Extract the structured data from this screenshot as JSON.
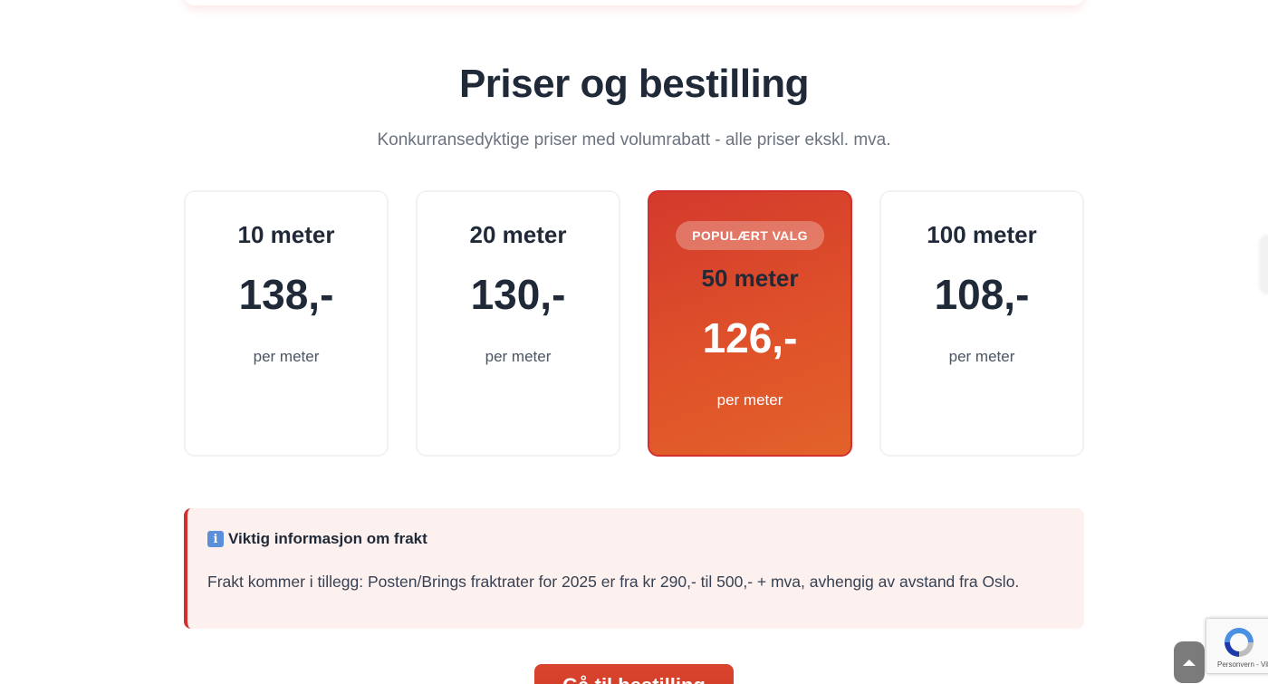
{
  "section": {
    "title": "Priser og bestilling",
    "subtitle": "Konkurransedyktige priser med volumrabatt - alle priser ekskl. mva."
  },
  "pricing": [
    {
      "quantity": "10 meter",
      "price": "138,-",
      "unit": "per meter",
      "featured": false
    },
    {
      "quantity": "20 meter",
      "price": "130,-",
      "unit": "per meter",
      "featured": false
    },
    {
      "quantity": "50 meter",
      "price": "126,-",
      "unit": "per meter",
      "featured": true,
      "badge": "POPULÆRT VALG"
    },
    {
      "quantity": "100 meter",
      "price": "108,-",
      "unit": "per meter",
      "featured": false
    }
  ],
  "info": {
    "icon": "info-icon",
    "icon_glyph": "i",
    "heading": "Viktig informasjon om frakt",
    "text": "Frakt kommer i tillegg: Posten/Brings fraktrater for 2025 er fra kr 290,- til 500,- + mva, avhengig av avstand fra Oslo."
  },
  "order_button": {
    "label": "Gå til bestilling"
  },
  "recaptcha": {
    "label": "Personvern - Vilkår"
  },
  "colors": {
    "accent": "#d32f2f",
    "featured_gradient_start": "#d33a2c",
    "featured_gradient_end": "#e2622a",
    "info_background": "#fdf1f0",
    "heading_text": "#1f2937",
    "muted_text": "#6b7280"
  }
}
